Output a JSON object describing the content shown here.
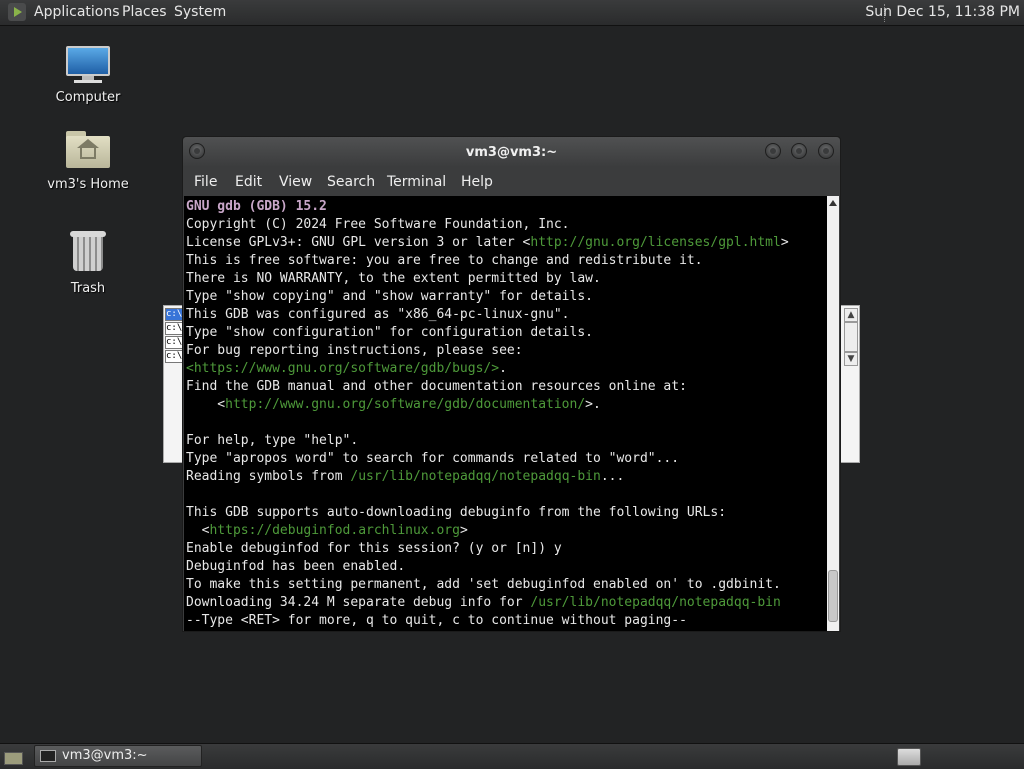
{
  "top_panel": {
    "applications": "Applications",
    "places": "Places",
    "system": "System",
    "clock": "Sun Dec 15, 11:38 PM"
  },
  "desktop": {
    "icons": [
      {
        "label": "Computer",
        "icon": "computer-icon"
      },
      {
        "label": "vm3's Home",
        "icon": "home-folder-icon"
      },
      {
        "label": "Trash",
        "icon": "trash-icon"
      }
    ]
  },
  "background_window": {
    "lines": [
      "c:\\",
      "c:\\",
      "c:\\",
      "c:\\"
    ]
  },
  "terminal": {
    "title": "vm3@vm3:~",
    "menu": [
      "File",
      "Edit",
      "View",
      "Search",
      "Terminal",
      "Help"
    ],
    "output": {
      "header": "GNU gdb (GDB) 15.2",
      "copyright": "Copyright (C) 2024 Free Software Foundation, Inc.",
      "license_prefix": "License GPLv3+: GNU GPL version 3 or later <",
      "license_url": "http://gnu.org/licenses/gpl.html",
      "license_suffix": ">",
      "free_software": "This is free software: you are free to change and redistribute it.",
      "no_warranty": "There is NO WARRANTY, to the extent permitted by law.",
      "show_copying": "Type \"show copying\" and \"show warranty\" for details.",
      "configured": "This GDB was configured as \"x86_64-pc-linux-gnu\".",
      "show_config": "Type \"show configuration\" for configuration details.",
      "bug_reporting": "For bug reporting instructions, please see:",
      "bugs_url": "<https://www.gnu.org/software/gdb/bugs/>",
      "bugs_suffix": ".",
      "manual": "Find the GDB manual and other documentation resources online at:",
      "doc_prefix": "    <",
      "doc_url": "http://www.gnu.org/software/gdb/documentation/",
      "doc_suffix": ">.",
      "help": "For help, type \"help\".",
      "apropos": "Type \"apropos word\" to search for commands related to \"word\"...",
      "reading_prefix": "Reading symbols from ",
      "reading_path": "/usr/lib/notepadqq/notepadqq-bin",
      "reading_suffix": "...",
      "debuginfod_supports": "This GDB supports auto-downloading debuginfo from the following URLs:",
      "debuginfod_prefix": "  <",
      "debuginfod_url": "https://debuginfod.archlinux.org",
      "debuginfod_suffix": ">",
      "enable_prompt": "Enable debuginfod for this session? (y or [n]) y",
      "enabled": "Debuginfod has been enabled.",
      "permanent": "To make this setting permanent, add 'set debuginfod enabled on' to .gdbinit.",
      "downloading_prefix": "Downloading 34.24 M separate debug info for ",
      "downloading_path": "/usr/lib/notepadqq/notepadqq-bin",
      "paging": "--Type <RET> for more, q to quit, c to continue without paging--"
    }
  },
  "bottom_panel": {
    "task_label": "vm3@vm3:~"
  }
}
